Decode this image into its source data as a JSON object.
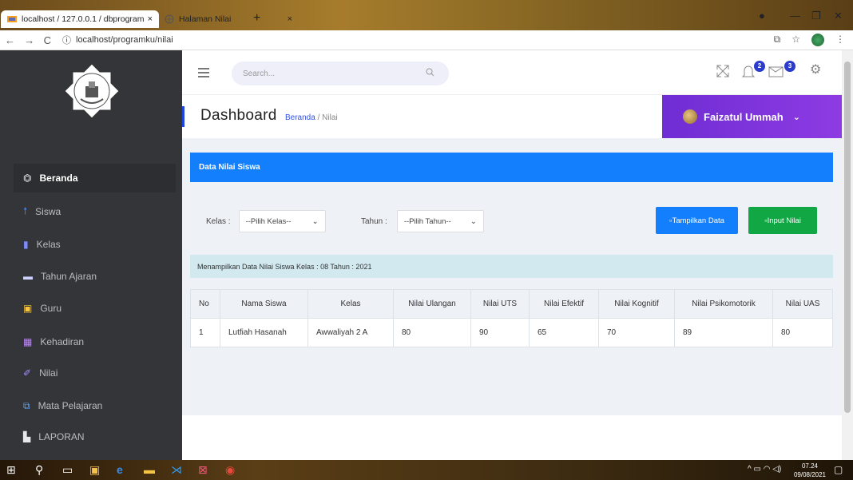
{
  "browser": {
    "tabs": [
      {
        "label": "localhost / 127.0.0.1 / dbprogram",
        "close": "×"
      },
      {
        "label": "Halaman Nilai",
        "close": "×"
      }
    ],
    "new_tab": "+",
    "url": "localhost/programku/nilai"
  },
  "sidebar": {
    "items": [
      {
        "label": "Beranda",
        "icon": "dashboard-icon"
      },
      {
        "label": "Siswa",
        "icon": "student-icon"
      },
      {
        "label": "Kelas",
        "icon": "book-icon"
      },
      {
        "label": "Tahun Ajaran",
        "icon": "folder-icon"
      },
      {
        "label": "Guru",
        "icon": "teacher-icon"
      },
      {
        "label": "Kehadiran",
        "icon": "table-icon"
      },
      {
        "label": "Nilai",
        "icon": "pen-icon"
      },
      {
        "label": "Mata Pelajaran",
        "icon": "copy-icon"
      },
      {
        "label": "LAPORAN",
        "icon": "file-icon"
      }
    ]
  },
  "topbar": {
    "search_placeholder": "Search...",
    "notif_count": "2",
    "mail_count": "3"
  },
  "header": {
    "title": "Dashboard",
    "crumb_home": "Beranda",
    "crumb_sep": " / ",
    "crumb_current": "Nilai",
    "user_name": "Faizatul Ummah"
  },
  "card": {
    "title": "Data Nilai Siswa",
    "kelas_label": "Kelas :",
    "kelas_value": "--Pilih Kelas--",
    "tahun_label": "Tahun :",
    "tahun_value": "--Pilih Tahun--",
    "btn_tampilkan": "Tampilkan Data",
    "btn_input": "Input Nilai",
    "info": "Menampilkan Data Nilai Siswa Kelas : 08 Tahun : 2021"
  },
  "table": {
    "headers": [
      "No",
      "Nama Siswa",
      "Kelas",
      "Nilai Ulangan",
      "Nilai UTS",
      "Nilai Efektif",
      "Nilai Kognitif",
      "Nilai Psikomotorik",
      "Nilai UAS"
    ],
    "rows": [
      [
        "1",
        "Lutfiah Hasanah",
        "Awwaliyah 2 A",
        "80",
        "90",
        "65",
        "70",
        "89",
        "80"
      ]
    ]
  },
  "taskbar": {
    "time": "07.24",
    "date": "09/08/2021"
  },
  "colors": {
    "primary": "#137ffc",
    "success": "#10a744",
    "purple": "#7b33db",
    "sidebar": "#333538"
  }
}
